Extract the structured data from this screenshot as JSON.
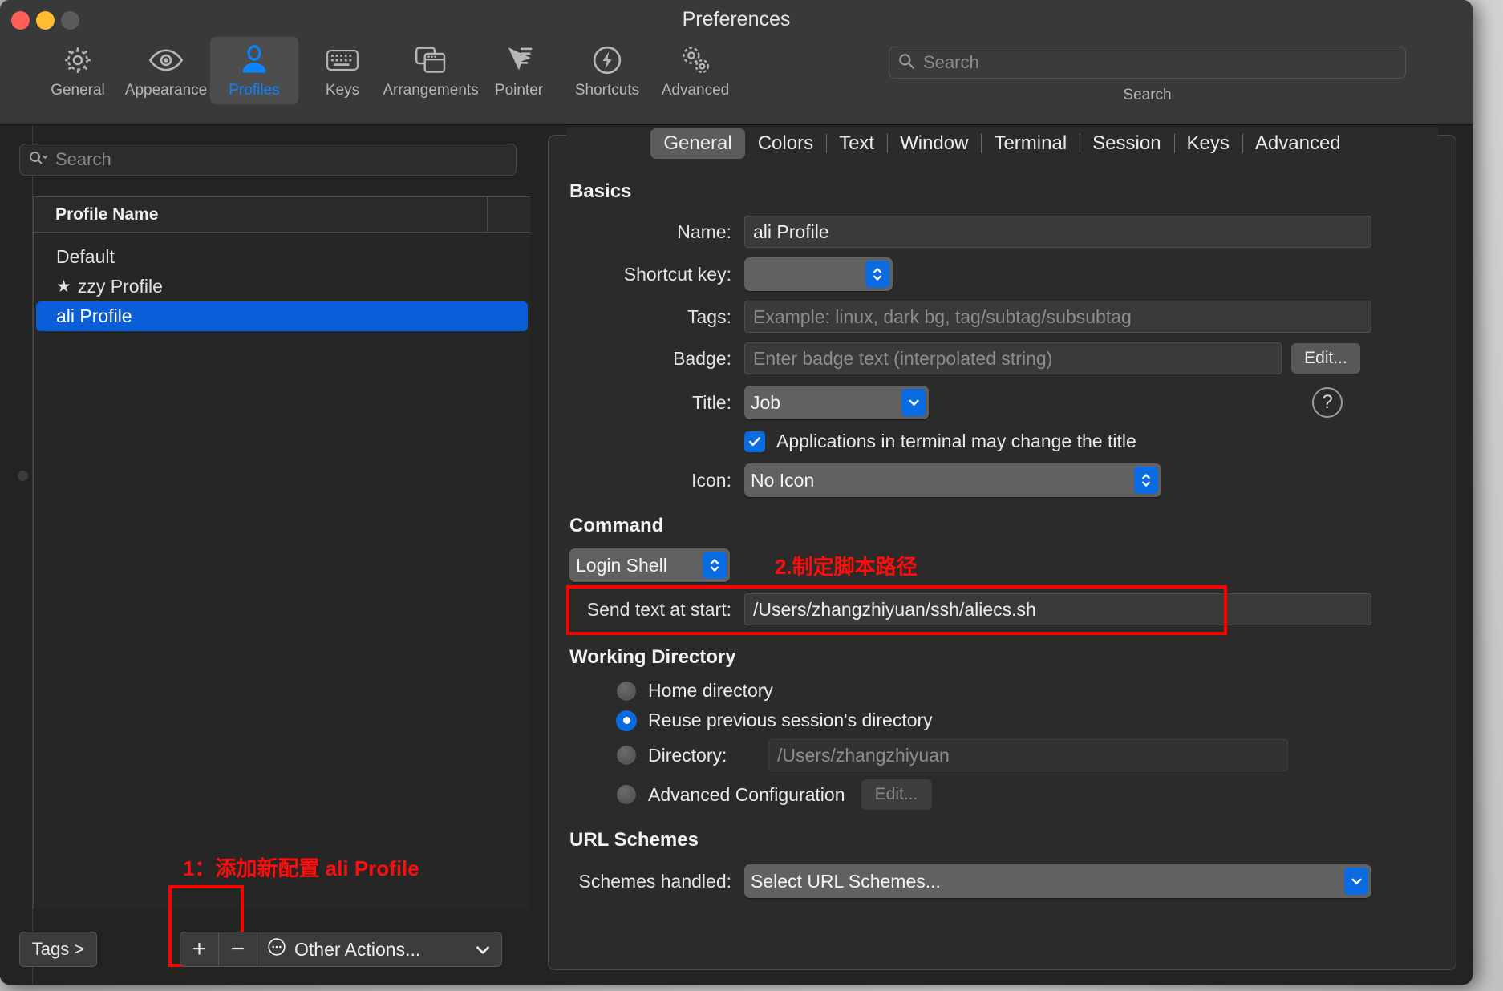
{
  "window": {
    "title": "Preferences"
  },
  "toolbar": {
    "items": [
      {
        "label": "General",
        "icon": "gear-icon"
      },
      {
        "label": "Appearance",
        "icon": "eye-icon"
      },
      {
        "label": "Profiles",
        "icon": "person-icon"
      },
      {
        "label": "Keys",
        "icon": "keyboard-icon"
      },
      {
        "label": "Arrangements",
        "icon": "windows-icon"
      },
      {
        "label": "Pointer",
        "icon": "cursor-icon"
      },
      {
        "label": "Shortcuts",
        "icon": "bolt-icon"
      },
      {
        "label": "Advanced",
        "icon": "gears-icon"
      }
    ],
    "selected": "Profiles",
    "search_placeholder": "Search",
    "search_value": "",
    "search_label": "Search"
  },
  "sidebar": {
    "search_placeholder": "Search",
    "search_value": "",
    "column_header": "Profile Name",
    "profiles": [
      {
        "name": "Default",
        "starred": false,
        "selected": false
      },
      {
        "name": "zzy Profile",
        "starred": true,
        "selected": false
      },
      {
        "name": "ali Profile",
        "starred": false,
        "selected": true
      }
    ],
    "tags_button": "Tags >",
    "add_button": "+",
    "remove_button": "−",
    "other_actions": "Other Actions...",
    "annotation_1": "1：添加新配置 ali Profile"
  },
  "tabs": {
    "items": [
      "General",
      "Colors",
      "Text",
      "Window",
      "Terminal",
      "Session",
      "Keys",
      "Advanced"
    ],
    "selected": "General"
  },
  "basics": {
    "heading": "Basics",
    "name_label": "Name:",
    "name_value": "ali Profile",
    "shortcut_label": "Shortcut key:",
    "shortcut_value": "",
    "tags_label": "Tags:",
    "tags_placeholder": "Example: linux, dark bg, tag/subtag/subsubtag",
    "tags_value": "",
    "badge_label": "Badge:",
    "badge_placeholder": "Enter badge text (interpolated string)",
    "badge_value": "",
    "badge_edit_button": "Edit...",
    "title_label": "Title:",
    "title_value": "Job",
    "help_button": "?",
    "app_change_title_label": "Applications in terminal may change the title",
    "app_change_title_checked": true,
    "icon_label": "Icon:",
    "icon_value": "No Icon"
  },
  "command": {
    "heading": "Command",
    "shell_value": "Login Shell",
    "send_text_label": "Send text at start:",
    "send_text_value": "/Users/zhangzhiyuan/ssh/aliecs.sh",
    "annotation_2": "2.制定脚本路径"
  },
  "working_directory": {
    "heading": "Working Directory",
    "options": [
      {
        "label": "Home directory",
        "selected": false
      },
      {
        "label": "Reuse previous session's directory",
        "selected": true
      },
      {
        "label": "Directory:",
        "selected": false
      },
      {
        "label": "Advanced Configuration",
        "selected": false
      }
    ],
    "directory_placeholder": "/Users/zhangzhiyuan",
    "directory_value": "",
    "advanced_edit_button": "Edit..."
  },
  "url_schemes": {
    "heading": "URL Schemes",
    "schemes_label": "Schemes handled:",
    "schemes_value": "Select URL Schemes..."
  },
  "colors": {
    "accent_blue": "#0a6ce0",
    "selection_blue": "#0a5fd8",
    "annotation_red": "#ff0d0d",
    "window_bg": "#232323",
    "panel_bg": "#2b2b2b"
  }
}
